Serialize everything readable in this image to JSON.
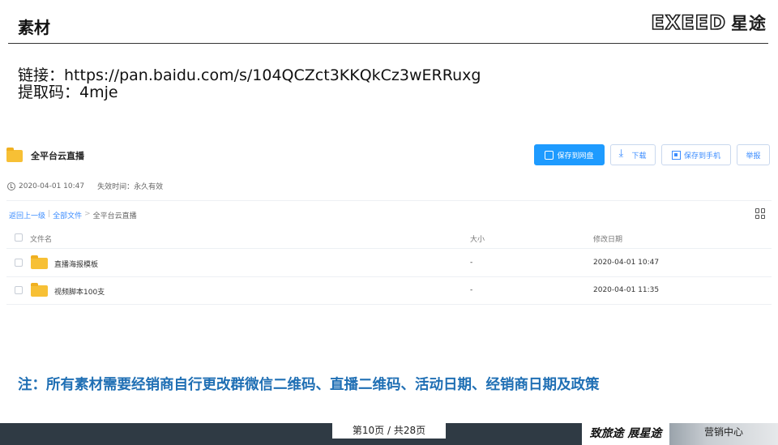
{
  "slide": {
    "title": "素材",
    "brand_en": "EXEED",
    "brand_cn": "星途",
    "link_line": "链接：https://pan.baidu.com/s/104QCZct3KKQkCz3wERRuxg",
    "code_line": "提取码：4mje",
    "note": "注：所有素材需要经销商自行更改群微信二维码、直播二维码、活动日期、经销商日期及政策"
  },
  "share": {
    "title": "全平台云直播",
    "buttons": {
      "save": "保存到网盘",
      "download": "下载",
      "save_phone": "保存到手机",
      "report": "举报"
    },
    "meta": {
      "created": "2020-04-01 10:47",
      "expiry": "失效时间：永久有效"
    },
    "breadcrumb": {
      "back": "返回上一级",
      "divider": "|",
      "all_files": "全部文件",
      "arrow": ">",
      "current": "全平台云直播"
    },
    "columns": {
      "name": "文件名",
      "size": "大小",
      "modified": "修改日期"
    },
    "files": [
      {
        "name": "直播海报模板",
        "size": "-",
        "modified": "2020-04-01 10:47"
      },
      {
        "name": "视频脚本100支",
        "size": "-",
        "modified": "2020-04-01 11:35"
      }
    ]
  },
  "footer": {
    "page": "第10页 / 共28页",
    "slogan": "致旅途 展星途",
    "dept": "营销中心"
  },
  "colors": {
    "accent_blue": "#1e9bff",
    "note_blue": "#1f6fb4",
    "folder_yellow": "#f7c035",
    "footer_dark": "#2f3a44"
  }
}
